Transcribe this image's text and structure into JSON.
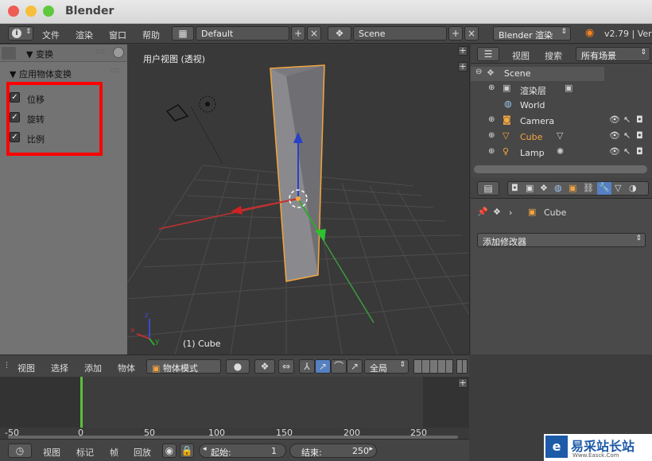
{
  "window": {
    "title": "Blender"
  },
  "topbar": {
    "menu": [
      "文件",
      "渲染",
      "窗口",
      "帮助"
    ],
    "layout_value": "Default",
    "scene_value": "Scene",
    "engine_value": "Blender 渲染",
    "version": "v2.79 | Ver"
  },
  "leftpanel": {
    "transform_label": "▼ 变换",
    "apply_label": "▼ 应用物体变换",
    "checks": [
      "位移",
      "旋转",
      "比例"
    ]
  },
  "viewport": {
    "label": "用户视图 (透视)",
    "object_label": "(1) Cube"
  },
  "outliner": {
    "view": "视图",
    "search": "搜索",
    "filter": "所有场景",
    "items": [
      "Scene",
      "渲染层",
      "World",
      "Camera",
      "Cube",
      "Lamp"
    ]
  },
  "properties": {
    "object_name": "Cube",
    "add_modifier": "添加修改器"
  },
  "vp_header": {
    "menu": [
      "视图",
      "选择",
      "添加",
      "物体"
    ],
    "mode": "物体模式",
    "orientation": "全局"
  },
  "timeline": {
    "ruler": [
      "-50",
      "0",
      "50",
      "100",
      "150",
      "200",
      "250"
    ],
    "menu": [
      "视图",
      "标记",
      "帧",
      "回放"
    ],
    "start": "起始:",
    "start_value": "1",
    "end": "结束:",
    "end_value": "250"
  },
  "watermark": {
    "text": "易采站长站",
    "sub": "Www.Easck.Com"
  },
  "colors": {
    "highlight": "#ff0000",
    "accent": "#5680c2",
    "selected": "#f4a640"
  }
}
